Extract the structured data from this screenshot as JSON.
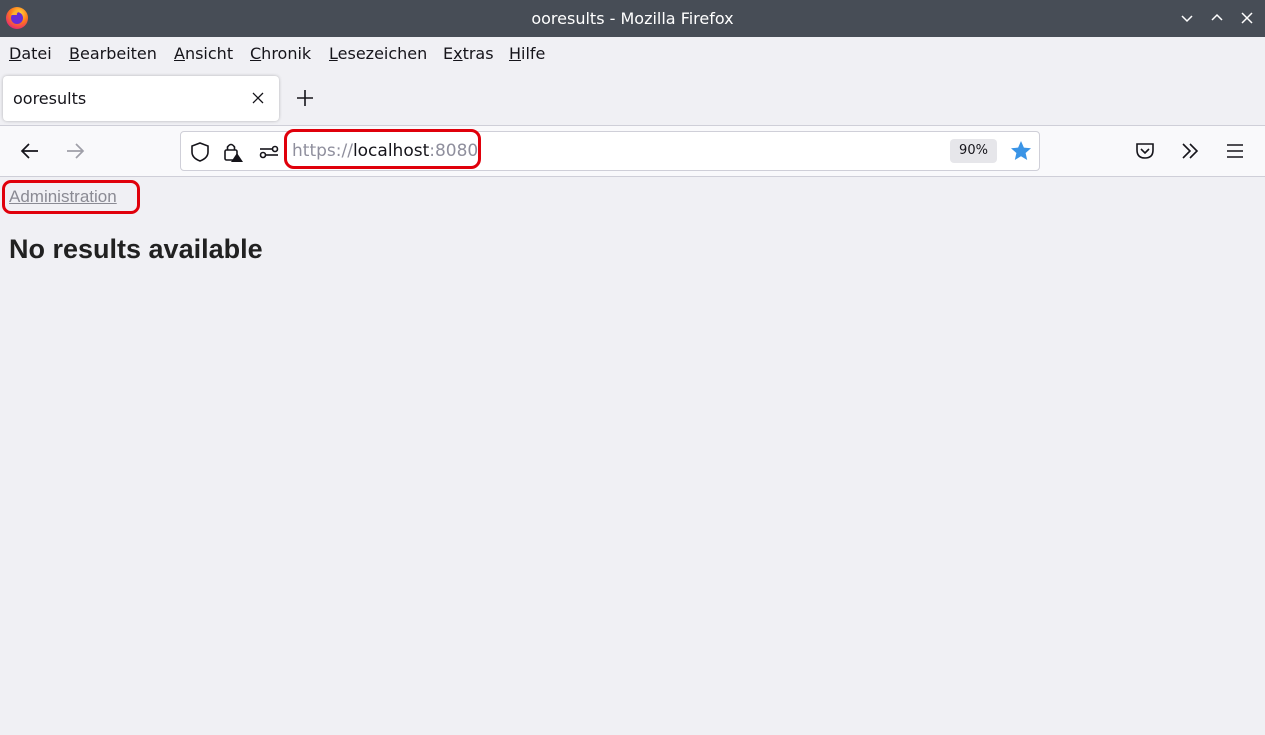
{
  "window": {
    "title": "ooresults - Mozilla Firefox"
  },
  "menubar": {
    "items": [
      {
        "accel": "D",
        "rest": "atei"
      },
      {
        "accel": "B",
        "rest": "earbeiten"
      },
      {
        "accel": "A",
        "rest": "nsicht"
      },
      {
        "accel": "C",
        "rest": "hronik"
      },
      {
        "accel": "L",
        "rest": "esezeichen"
      },
      {
        "pre": "E",
        "accel": "x",
        "rest": "tras"
      },
      {
        "accel": "H",
        "rest": "ilfe"
      }
    ]
  },
  "tabs": [
    {
      "label": "ooresults"
    }
  ],
  "navbar": {
    "url_scheme": "https://",
    "url_host": "localhost",
    "url_port": ":8080",
    "zoom": "90%"
  },
  "page": {
    "admin_link": "Administration",
    "heading": "No results available"
  },
  "colors": {
    "highlight": "#e0000b",
    "titlebar": "#474d56",
    "bookmark_star": "#3a94e6"
  },
  "icons": [
    "firefox-logo-icon",
    "minimize-icon",
    "maximize-icon",
    "close-window-icon",
    "tab-close-icon",
    "new-tab-icon",
    "back-icon",
    "forward-icon",
    "shield-icon",
    "lock-warning-icon",
    "permissions-icon",
    "bookmark-star-icon",
    "pocket-icon",
    "overflow-icon",
    "hamburger-menu-icon"
  ]
}
